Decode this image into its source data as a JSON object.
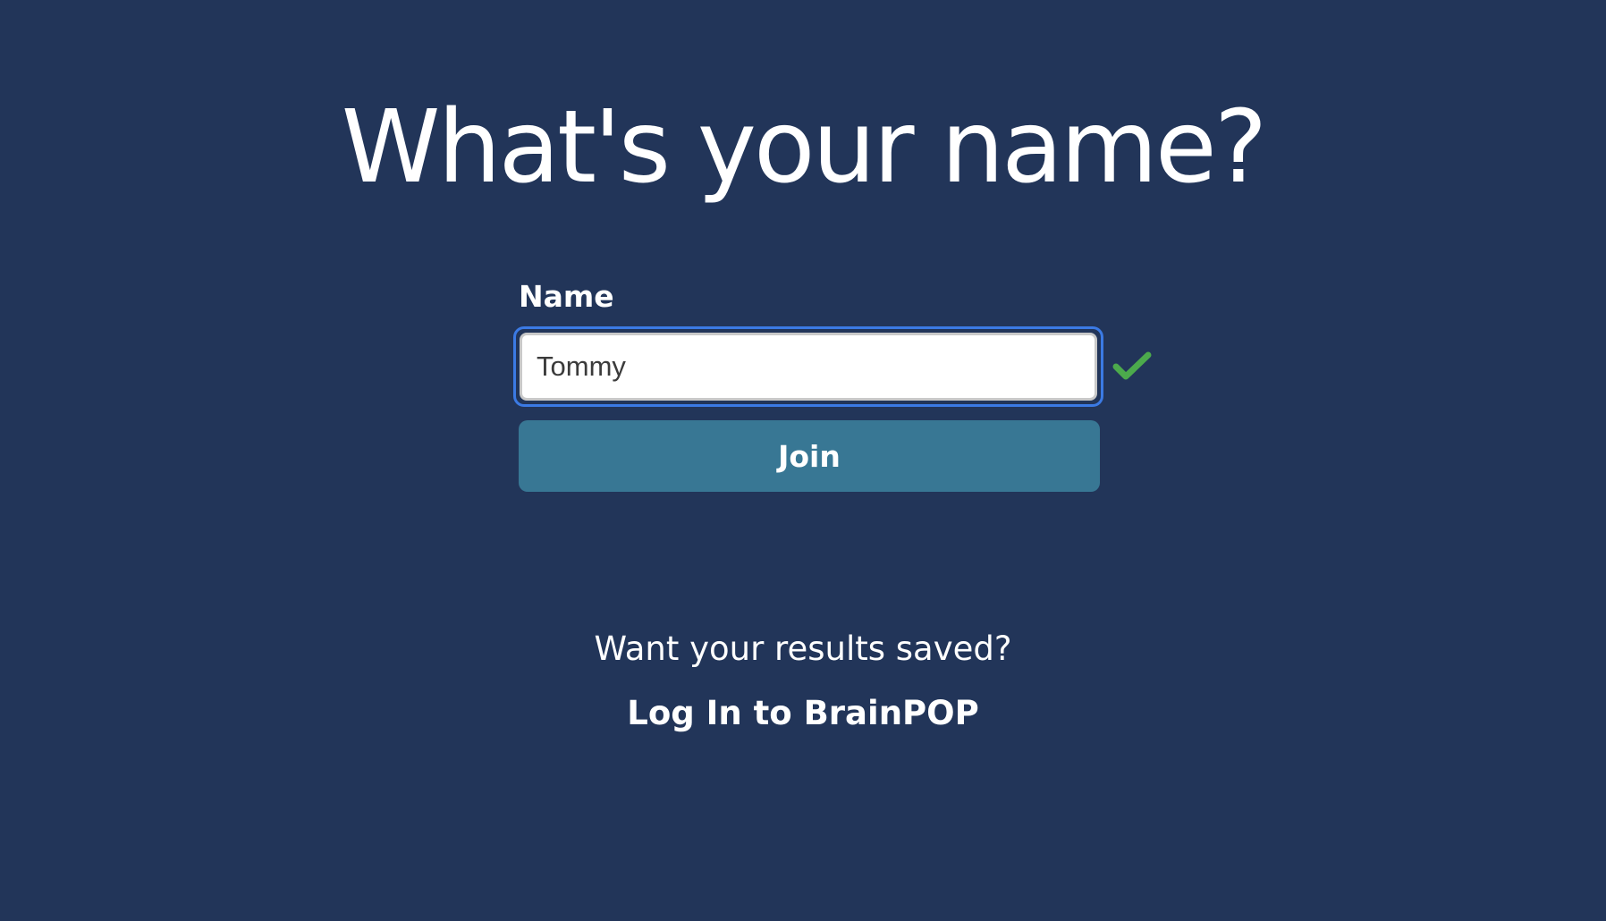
{
  "heading": "What's your name?",
  "form": {
    "name_label": "Name",
    "name_value": "Tommy",
    "validation_icon": "check-icon",
    "join_label": "Join"
  },
  "footer": {
    "prompt": "Want your results saved?",
    "login_label": "Log In to BrainPOP"
  },
  "colors": {
    "background": "#223559",
    "button": "#387794",
    "focus_ring": "#3b7ae4",
    "check": "#4caa4c"
  }
}
